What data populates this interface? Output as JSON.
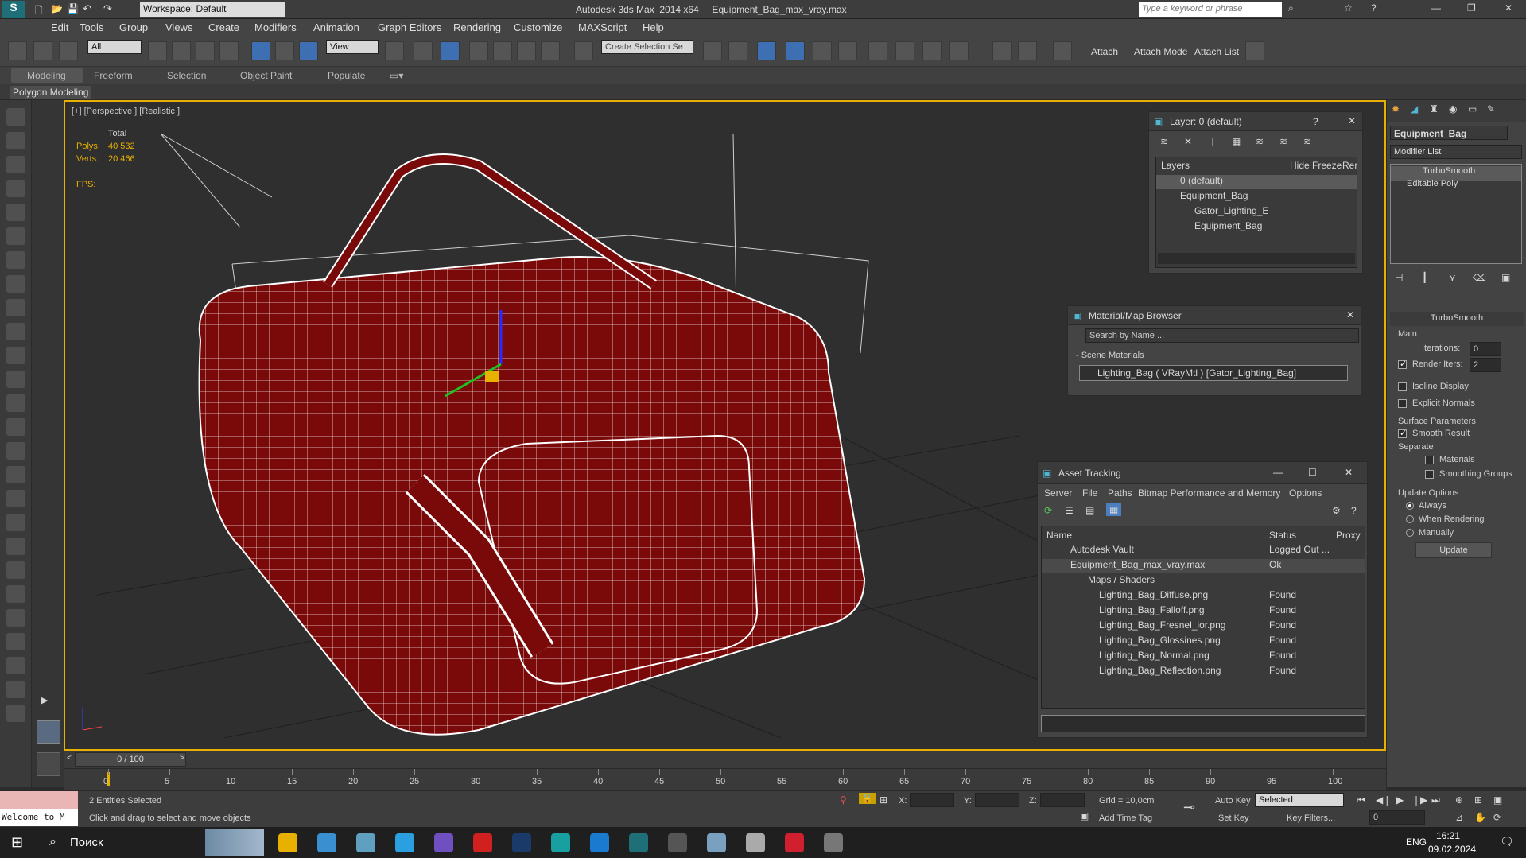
{
  "app": {
    "title": "Autodesk 3ds Max  2014 x64     Equipment_Bag_max_vray.max",
    "workspace": "Workspace: Default",
    "search_placeholder": "Type a keyword or phrase"
  },
  "menu": [
    "Edit",
    "Tools",
    "Group",
    "Views",
    "Create",
    "Modifiers",
    "Animation",
    "Graph Editors",
    "Rendering",
    "Customize",
    "MAXScript",
    "Help"
  ],
  "toolbar": {
    "filter": "All",
    "refcoord": "View",
    "selset": "Create Selection Se",
    "attach": "Attach",
    "attach_mode": "Attach Mode",
    "attach_list": "Attach List"
  },
  "ribbon": {
    "tabs": [
      "Modeling",
      "Freeform",
      "Selection",
      "Object Paint",
      "Populate"
    ],
    "sub": "Polygon Modeling"
  },
  "viewport": {
    "label": "[+] [Perspective ] [Realistic ]",
    "stats_total": "Total",
    "polys_label": "Polys:",
    "polys": "40 532",
    "verts_label": "Verts:",
    "verts": "20 466",
    "fps": "FPS:"
  },
  "layers": {
    "title": "Layer: 0 (default)",
    "help": "?",
    "cols": [
      "Layers",
      "Hide",
      "Freeze",
      "Rer"
    ],
    "rows": [
      "0 (default)",
      "Equipment_Bag",
      "Gator_Lighting_E",
      "Equipment_Bag"
    ]
  },
  "matbrowser": {
    "title": "Material/Map Browser",
    "search": "Search by Name ...",
    "section": "- Scene Materials",
    "item": "Lighting_Bag  ( VRayMtl ) [Gator_Lighting_Bag]"
  },
  "assets": {
    "title": "Asset Tracking",
    "menu": [
      "Server",
      "File",
      "Paths",
      "Bitmap Performance and Memory",
      "Options"
    ],
    "cols": [
      "Name",
      "Status",
      "Proxy"
    ],
    "rows": [
      {
        "name": "Autodesk Vault",
        "status": "Logged Out ..."
      },
      {
        "name": "Equipment_Bag_max_vray.max",
        "status": "Ok"
      },
      {
        "name": "Maps / Shaders",
        "status": ""
      },
      {
        "name": "Lighting_Bag_Diffuse.png",
        "status": "Found"
      },
      {
        "name": "Lighting_Bag_Falloff.png",
        "status": "Found"
      },
      {
        "name": "Lighting_Bag_Fresnel_ior.png",
        "status": "Found"
      },
      {
        "name": "Lighting_Bag_Glossines.png",
        "status": "Found"
      },
      {
        "name": "Lighting_Bag_Normal.png",
        "status": "Found"
      },
      {
        "name": "Lighting_Bag_Reflection.png",
        "status": "Found"
      }
    ]
  },
  "cmdpanel": {
    "object": "Equipment_Bag",
    "modlist": "Modifier List",
    "stack": [
      "TurboSmooth",
      "Editable Poly"
    ],
    "rollout": "TurboSmooth",
    "main": "Main",
    "iterations_label": "Iterations:",
    "iterations": "0",
    "render_iters_label": "Render Iters:",
    "render_iters": "2",
    "isoline": "Isoline Display",
    "explicit": "Explicit Normals",
    "surface": "Surface Parameters",
    "smooth": "Smooth Result",
    "separate": "Separate",
    "materials": "Materials",
    "smoothing": "Smoothing Groups",
    "update_opts": "Update Options",
    "always": "Always",
    "when_rendering": "When Rendering",
    "manually": "Manually",
    "update": "Update"
  },
  "timeline": {
    "frame": "0 / 100",
    "ticks": [
      "0",
      "5",
      "10",
      "15",
      "20",
      "25",
      "30",
      "35",
      "40",
      "45",
      "50",
      "55",
      "60",
      "65",
      "70",
      "75",
      "80",
      "85",
      "90",
      "95",
      "100"
    ]
  },
  "status": {
    "welcome": "Welcome to M",
    "selected": "2 Entities Selected",
    "hint": "Click and drag to select and move objects",
    "x": "X:",
    "y": "Y:",
    "z": "Z:",
    "grid": "Grid = 10,0cm",
    "add_time_tag": "Add Time Tag",
    "auto_key": "Auto Key",
    "set_key": "Set Key",
    "key_mode": "Selected",
    "key_filters": "Key Filters...",
    "frame_field": "0"
  },
  "taskbar": {
    "search": "Поиск",
    "lang": "ENG",
    "time": "16:21",
    "date": "09.02.2024"
  }
}
